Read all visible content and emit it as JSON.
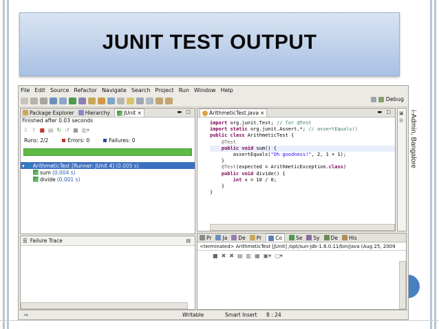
{
  "slide": {
    "title": "JUNIT  TEST OUTPUT",
    "side_label": "i-Admin, Bangalore"
  },
  "menu": [
    "File",
    "Edit",
    "Source",
    "Refactor",
    "Navigate",
    "Search",
    "Project",
    "Run",
    "Window",
    "Help"
  ],
  "perspective": {
    "label": "Debug"
  },
  "left_tabs": [
    "Package Explorer",
    "Hierarchy",
    "JUnit"
  ],
  "junit": {
    "status": "Finished after 0.03 seconds",
    "runs_label": "Runs:",
    "runs_value": "2/2",
    "errors_label": "Errors:",
    "errors_value": "0",
    "failures_label": "Failures:",
    "failures_value": "0",
    "colors": {
      "bar": "#5dbb45",
      "error": "#c0392b",
      "failure": "#2c4c9a"
    },
    "tree": {
      "root_label": "ArithmeticTest [Runner: JUnit 4]",
      "root_time": "(0.005 s)",
      "children": [
        {
          "label": "sum",
          "time": "(0.004 s)"
        },
        {
          "label": "divide",
          "time": "(0.001 s)"
        }
      ]
    }
  },
  "failure_trace": {
    "label": "Failure Trace"
  },
  "editor": {
    "tab": "ArithmeticTest.java",
    "lines": [
      [
        {
          "t": "import ",
          "c": "kw"
        },
        {
          "t": "org.junit.Test; "
        },
        {
          "t": "// for @Test",
          "c": "cm"
        }
      ],
      [
        {
          "t": "import static ",
          "c": "kw"
        },
        {
          "t": "org.junit.Assert.*; "
        },
        {
          "t": "// assertEquals()",
          "c": "cm"
        }
      ],
      [
        {
          "t": ""
        }
      ],
      [
        {
          "t": "public class ",
          "c": "kw"
        },
        {
          "t": "ArithmeticTest {"
        }
      ],
      [
        {
          "t": ""
        }
      ],
      [
        {
          "t": "    @Test",
          "c": "an"
        }
      ],
      [
        {
          "t": "    public void ",
          "c": "kw"
        },
        {
          "t": "sum() {"
        }
      ],
      [
        {
          "t": "        assertEquals("
        },
        {
          "t": "\"Oh goodness!\"",
          "c": "st"
        },
        {
          "t": ", 2, 1 + 1);"
        }
      ],
      [
        {
          "t": "    }"
        }
      ],
      [
        {
          "t": ""
        }
      ],
      [
        {
          "t": "    @Test",
          "c": "an"
        },
        {
          "t": "(expected = ArithmeticException."
        },
        {
          "t": "class",
          "c": "kw"
        },
        {
          "t": ")"
        }
      ],
      [
        {
          "t": "    public void ",
          "c": "kw"
        },
        {
          "t": "divide() {"
        }
      ],
      [
        {
          "t": "        int ",
          "c": "kw"
        },
        {
          "t": "x = 10 / 0;"
        }
      ],
      [
        {
          "t": "    }"
        }
      ],
      [
        {
          "t": "}"
        }
      ]
    ]
  },
  "bottom_tabs": [
    "Pr",
    "Ja",
    "De",
    "Pr",
    "Co",
    "Se",
    "Sy",
    "De",
    "His"
  ],
  "console": {
    "header": "<terminated> ArithmeticTest [JUnit] /opt/sun-jdk-1.6.0.11/bin/java (Aug 25, 2009"
  },
  "statusbar": {
    "mode": "Writable",
    "insert": "Smart Insert",
    "position": "8 : 24"
  }
}
